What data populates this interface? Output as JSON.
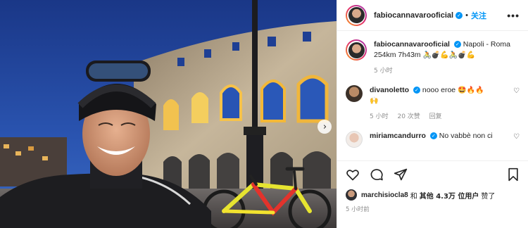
{
  "post": {
    "author": "fabiocannavarooficial",
    "follow_label": "关注",
    "more_label": "•••",
    "caption_line1": "Napoli - Roma",
    "caption_line2": "254km 7h43m",
    "caption_emojis": "🚴💣💪🚴💣💪",
    "caption_time": "5 小时"
  },
  "comments": [
    {
      "user": "divanoletto",
      "text": "nooo eroe",
      "emojis": "🤩🔥🔥",
      "line2_emojis": "🙌",
      "time": "5 小时",
      "likes": "20 次赞",
      "reply_label": "回复"
    },
    {
      "user": "miriamcandurro",
      "text": "No vabbè non ci"
    }
  ],
  "likes": {
    "user": "marchisiocla8",
    "and_label": "和",
    "others_label": "其他 4.3万 位用户",
    "suffix": "赞了"
  },
  "post_time": "5 小时前",
  "photo": {
    "next_icon": "chevron-right-icon"
  },
  "colors": {
    "accent": "#0095f6",
    "sky": "#1f3c86",
    "stone_lit": "#c9b89a"
  }
}
